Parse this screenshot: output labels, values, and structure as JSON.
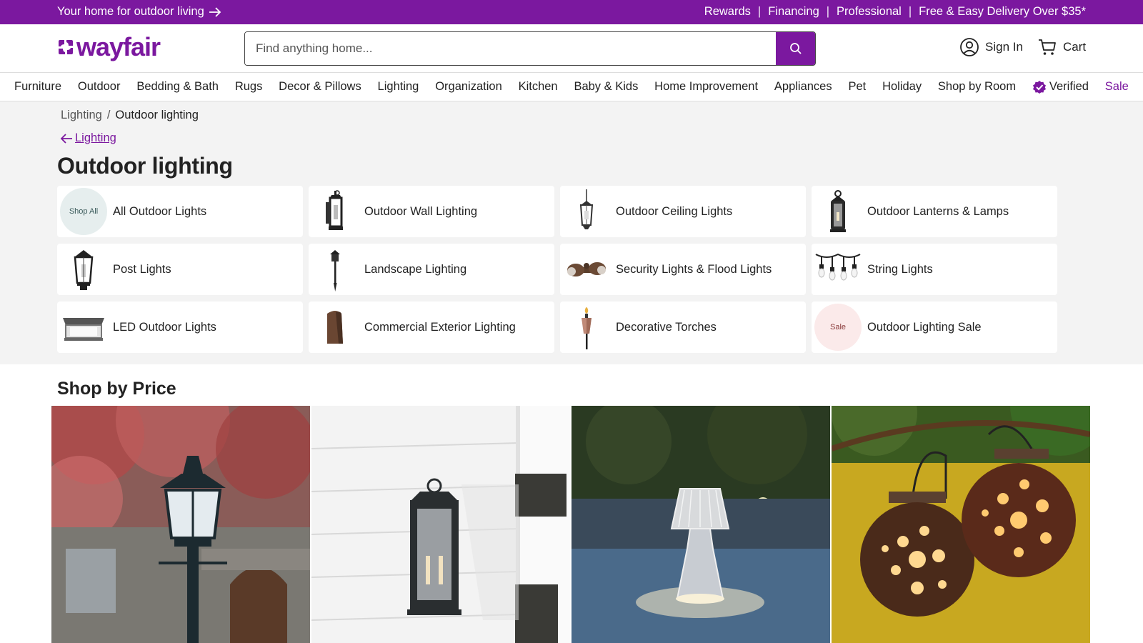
{
  "promo": {
    "left_text": "Your home for outdoor living",
    "links": [
      "Rewards",
      "Financing",
      "Professional",
      "Free & Easy Delivery Over $35*"
    ],
    "separator": "|"
  },
  "header": {
    "logo_text": "wayfair",
    "search_placeholder": "Find anything home...",
    "sign_in": "Sign In",
    "cart": "Cart"
  },
  "nav": {
    "items": [
      "Furniture",
      "Outdoor",
      "Bedding & Bath",
      "Rugs",
      "Decor & Pillows",
      "Lighting",
      "Organization",
      "Kitchen",
      "Baby & Kids",
      "Home Improvement",
      "Appliances",
      "Pet",
      "Holiday",
      "Shop by Room"
    ],
    "verified": "Verified",
    "sale": "Sale"
  },
  "breadcrumb": {
    "parent": "Lighting",
    "separator": "/",
    "current": "Outdoor lighting"
  },
  "back_link": "Lighting",
  "page_title": "Outdoor lighting",
  "categories": [
    {
      "label": "All Outdoor Lights",
      "badge": "Shop All"
    },
    {
      "label": "Outdoor Wall Lighting"
    },
    {
      "label": "Outdoor Ceiling Lights"
    },
    {
      "label": "Outdoor Lanterns & Lamps"
    },
    {
      "label": "Post Lights"
    },
    {
      "label": "Landscape Lighting"
    },
    {
      "label": "Security Lights & Flood Lights"
    },
    {
      "label": "String Lights"
    },
    {
      "label": "LED Outdoor Lights"
    },
    {
      "label": "Commercial Exterior Lighting"
    },
    {
      "label": "Decorative Torches"
    },
    {
      "label": "Outdoor Lighting Sale",
      "badge": "Sale"
    }
  ],
  "shop_by_price": {
    "title": "Shop by Price"
  },
  "colors": {
    "brand": "#7b189f",
    "background_gray": "#f3f3f3",
    "sale_badge_bg": "#fbeaea",
    "shop_all_badge_bg": "#e6eeee"
  }
}
